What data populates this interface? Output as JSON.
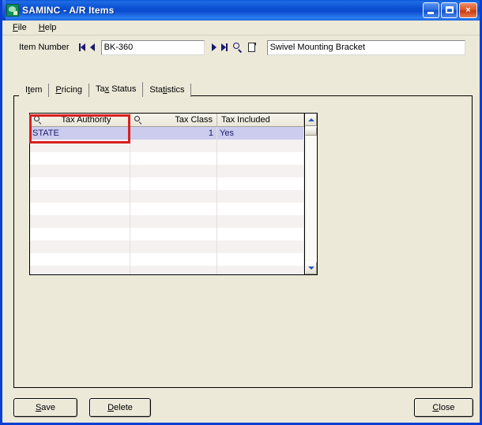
{
  "window": {
    "title": "SAMINC - A/R Items",
    "icon": "app-icon",
    "caption_buttons": {
      "minimize": "minimize-button",
      "maximize": "maximize-button",
      "close": "×"
    }
  },
  "menubar": {
    "items": [
      {
        "label": "File",
        "accel": "F",
        "rest": "ile"
      },
      {
        "label": "Help",
        "accel": "H",
        "rest": "elp"
      }
    ]
  },
  "toolbar": {
    "item_number_label": "Item Number",
    "item_number_value": "BK-360",
    "item_number_placeholder": "",
    "description_value": "Swivel Mounting Bracket",
    "description_placeholder": "",
    "nav": {
      "first": "first-record",
      "previous": "previous-record",
      "next": "next-record",
      "last": "last-record",
      "find": "find-record",
      "new": "new-record"
    }
  },
  "tabs": [
    {
      "label": "Item",
      "accel": "t",
      "pre": "I",
      "post": "em",
      "active": false
    },
    {
      "label": "Pricing",
      "accel": "P",
      "pre": "",
      "post": "ricing",
      "active": false
    },
    {
      "label": "Tax Status",
      "accel": "x",
      "pre": "Ta",
      "post": " Status",
      "active": true
    },
    {
      "label": "Statistics",
      "accel": "ti",
      "pre": "Sta",
      "post": "stics",
      "active": false
    }
  ],
  "grid": {
    "columns": [
      {
        "header": "Tax Authority",
        "align": "left",
        "has_finder": true
      },
      {
        "header": "Tax Class",
        "align": "right",
        "has_finder": true
      },
      {
        "header": "Tax Included",
        "align": "left",
        "has_finder": false
      }
    ],
    "rows": [
      {
        "authority": "STATE",
        "tax_class": "1",
        "tax_included": "Yes",
        "selected": true
      }
    ],
    "empty_row_count": 12,
    "scrollbar": {
      "up_arrow": "scroll-up",
      "down_arrow": "scroll-down"
    }
  },
  "annotation": {
    "highlight_color": "#d91f1f",
    "target": "tax-authority-column"
  },
  "buttons": {
    "save": {
      "label": "Save",
      "accel": "S",
      "pre": "",
      "post": "ave"
    },
    "delete": {
      "label": "Delete",
      "accel": "D",
      "pre": "",
      "post": "elete"
    },
    "close": {
      "label": "Close",
      "accel": "C",
      "pre": "",
      "post": "lose"
    }
  },
  "colors": {
    "titlebar_blue": "#0a4fd2",
    "window_frame": "#0a3fd4",
    "face": "#ece9d8",
    "selected_row": "#ccccee",
    "grid_text": "#1a1a6e",
    "annotation_red": "#d91f1f"
  }
}
